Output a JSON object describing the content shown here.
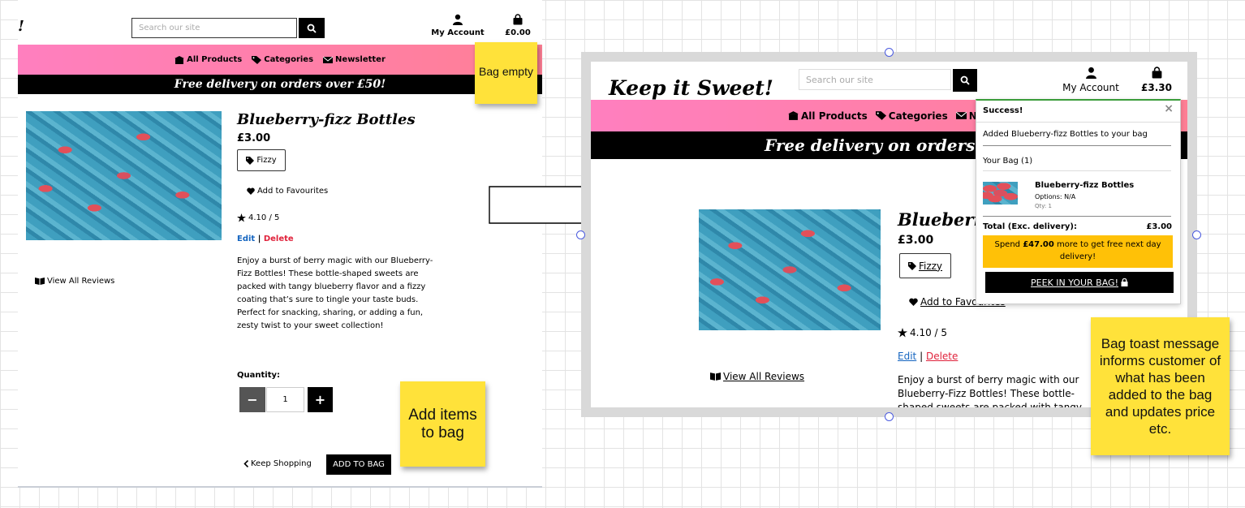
{
  "left": {
    "logo_fragment": "!",
    "search_placeholder": "Search our site",
    "account_label": "My Account",
    "bag_total": "£0.00",
    "nav": [
      "All Products",
      "Categories",
      "Newsletter"
    ],
    "promo": "Free delivery on orders over £50!",
    "product": {
      "title": "Blueberry-fizz Bottles",
      "price": "£3.00",
      "tag": "Fizzy",
      "favourites": "Add to Favourites",
      "rating": "4.10 / 5",
      "edit": "Edit",
      "sep": "|",
      "delete": "Delete",
      "description": "Enjoy a burst of berry magic with our Blueberry-Fizz Bottles! These bottle-shaped sweets are packed with tangy blueberry flavor and a fizzy coating that’s sure to tingle your taste buds. Perfect for snacking, sharing, or adding a fun, zesty twist to your sweet collection!",
      "reviews": "View All Reviews",
      "quantity_label": "Quantity:",
      "quantity": "1",
      "minus": "−",
      "plus": "+",
      "keep_shopping": "Keep Shopping",
      "add_to_bag": "ADD TO BAG"
    }
  },
  "right": {
    "logo": "Keep it Sweet!",
    "search_placeholder": "Search our site",
    "account_label": "My Account",
    "bag_total": "£3.30",
    "nav": [
      "All Products",
      "Categories",
      "News"
    ],
    "promo": "Free delivery on orders over",
    "product": {
      "title": "Blueberry",
      "price": "£3.00",
      "tag": "Fizzy",
      "favourites": "Add to Favourites",
      "rating": "4.10 / 5",
      "edit": "Edit",
      "sep": "|",
      "delete": "Delete",
      "reviews": "View All Reviews",
      "desc_lines": [
        "Enjoy a burst of berry magic with our",
        "Blueberry-Fizz Bottles! These bottle-",
        "shaped sweets are packed with tangy"
      ]
    },
    "toast": {
      "title": "Success!",
      "close": "×",
      "message": "Added Blueberry-fizz Bottles to your bag",
      "your_bag": "Your Bag (1)",
      "item_name": "Blueberry-fizz Bottles",
      "item_options": "Options: N/A",
      "item_qty": "Qty: 1",
      "total_label": "Total (Exc. delivery):",
      "total_value": "£3.00",
      "spend_prefix": "Spend ",
      "spend_amount": "£47.00",
      "spend_suffix": " more to get free next day delivery!",
      "peek": "PEEK IN YOUR BAG!"
    }
  },
  "notes": {
    "bag_empty": "Bag empty",
    "add_items": "Add items to bag",
    "toast_info": "Bag toast message informs customer of what has been added to the bag and updates price etc."
  },
  "colors": {
    "nav_pink": "#ff7fbf",
    "edit_blue": "#1565c0",
    "delete_red": "#e0223b",
    "toast_yellow": "#ffc107",
    "sticky_yellow": "#ffe23a"
  }
}
